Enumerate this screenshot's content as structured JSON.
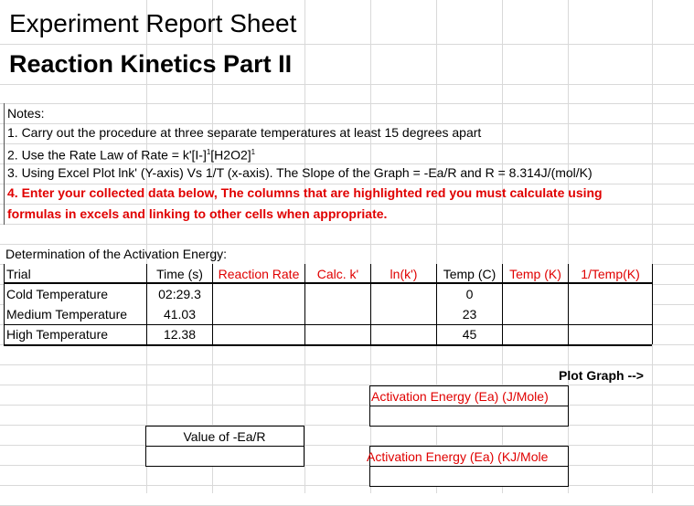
{
  "title": "Experiment  Report Sheet",
  "subtitle": "Reaction Kinetics Part II",
  "notes": {
    "heading": "Notes:",
    "items": [
      "1. Carry out the procedure at three separate temperatures at least 15 degrees apart",
      "2. Use the Rate Law of Rate = k'[I-]",
      "3. Using Excel Plot lnk' (Y-axis) Vs 1/T (x-axis). The Slope of the Graph = -Ea/R and R = 8.314J/(mol/K)",
      "4. Enter your collected data below, The columns that are highlighted red you must calculate using",
      "formulas in excels and linking to other cells when appropriate."
    ],
    "exp": "1",
    "h2o2": "[H2O2]"
  },
  "table": {
    "caption": "Determination of the Activation Energy:",
    "headers": [
      "Trial",
      "Time (s)",
      "Reaction Rate",
      "Calc. k'",
      "ln(k')",
      "Temp (C)",
      "Temp (K)",
      "1/Temp(K)"
    ],
    "rows": [
      [
        "Cold Temperature",
        "02:29.3",
        "",
        "",
        "",
        "0",
        "",
        ""
      ],
      [
        "Medium Temperature",
        "41.03",
        "",
        "",
        "",
        "23",
        "",
        ""
      ],
      [
        "High Temperature",
        "12.38",
        "",
        "",
        "",
        "45",
        "",
        ""
      ]
    ]
  },
  "plot_graph": "Plot Graph -->",
  "ea_j_label": "Activation Energy (Ea) (J/Mole)",
  "ea_kj_label": "Activation Energy (Ea) (KJ/Mole",
  "slope_label": "Value of -Ea/R"
}
